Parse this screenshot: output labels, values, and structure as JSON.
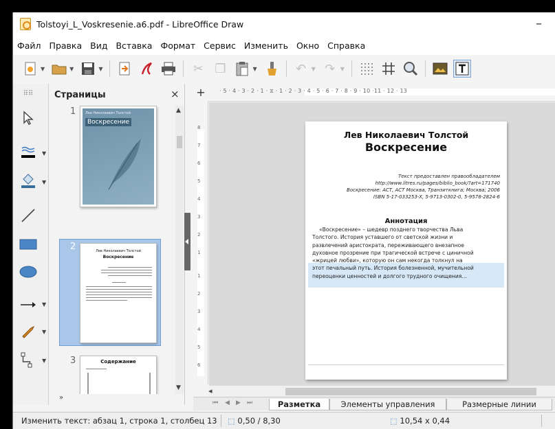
{
  "window": {
    "title": "Tolstoyi_L_Voskresenie.a6.pdf - LibreOffice Draw",
    "minimize": "–"
  },
  "menu": [
    "Файл",
    "Правка",
    "Вид",
    "Вставка",
    "Формат",
    "Сервис",
    "Изменить",
    "Окно",
    "Справка"
  ],
  "toolbar": {
    "icons": [
      "new-document-icon",
      "open-folder-icon",
      "save-icon",
      "export-icon",
      "export-pdf-icon",
      "print-icon",
      "cut-icon",
      "copy-icon",
      "paste-icon",
      "clone-formatting-icon",
      "undo-icon",
      "redo-icon",
      "grid-icon",
      "helplines-icon",
      "zoom-icon",
      "image-icon",
      "text-box-icon"
    ]
  },
  "left_tools": [
    "select-icon",
    "line-color-icon",
    "fill-color-icon",
    "line-icon",
    "rectangle-icon",
    "ellipse-icon",
    "arrow-line-icon",
    "curve-icon",
    "connector-icon"
  ],
  "pages_panel": {
    "title": "Страницы",
    "close": "×",
    "pages": [
      {
        "number": "1",
        "author": "Лев Николаевич Толстой",
        "title": "Воскресение"
      },
      {
        "number": "2",
        "author": "Лев Николаевич Толстой",
        "title": "Воскресение"
      },
      {
        "number": "3",
        "title": "Содержание"
      }
    ],
    "more": "»"
  },
  "ruler": {
    "horizontal": "· 5 · 4 · 3 · 2 · 1 · ⧖ · 1 · 2 · 3 · 4 · 5 · 6 · 7 · 8 · 9 · 10 ·11 · 12 · 13",
    "vertical": [
      "8",
      "7",
      "6",
      "5",
      "4",
      "3",
      "2",
      "1",
      "1",
      "2",
      "3",
      "4",
      "5",
      "6"
    ]
  },
  "document": {
    "author": "Лев Николаевич Толстой",
    "book_title": "Воскресение",
    "meta": [
      "Текст предоставлен правообладателем",
      "http://www.litres.ru/pages/biblio_book/?art=171740",
      "Воскресение: АСТ, АСТ Москва, Транзиткнига; Москва; 2006",
      "ISBN 5-17-033253-X, 5-9713-0302-0, 5-9578-2824-6"
    ],
    "annotation_heading": "Аннотация",
    "body_lines": [
      "«Воскресение» – шедевр позднего творчества Льва",
      "Толстого. История уставшего от светской жизни и",
      "развлечений аристократа, переживающего внезапное",
      "духовное прозрение при трагической встрече с циничной",
      "«жрицей любви», которую он сам некогда толкнул на",
      "этот печальный путь. История болезненной, мучительной",
      "переоценки ценностей и долгого трудного очищения…"
    ]
  },
  "tabs": {
    "nav": [
      "⏮",
      "◀",
      "▶",
      "⏭"
    ],
    "items": [
      "Разметка",
      "Элементы управления",
      "Размерные линии"
    ],
    "active": 0
  },
  "status": {
    "edit": "Изменить текст: абзац 1, строка 1, столбец 13",
    "position": "0,50 / 8,30",
    "size": "10,54 x 0,44"
  }
}
